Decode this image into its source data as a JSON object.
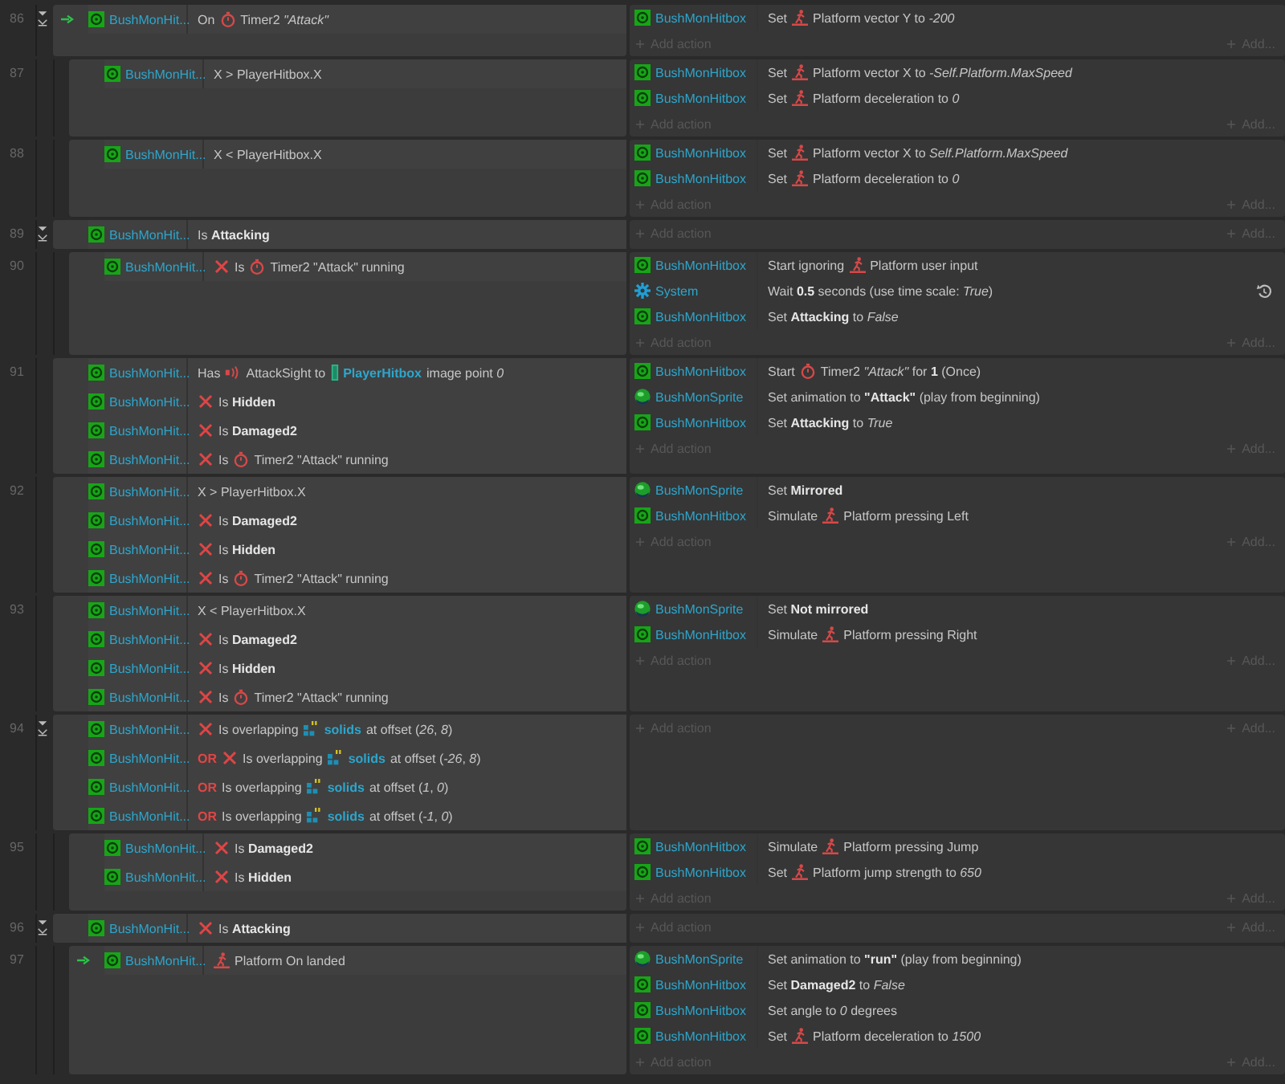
{
  "events": [
    {
      "number": "86",
      "trigger": true,
      "expanded": true,
      "conditions": [
        {
          "kind": "hitbox",
          "object": "BushMonHit...",
          "inverted": false,
          "parts": [
            {
              "kind": "text",
              "text": "On"
            },
            {
              "kind": "timer"
            },
            {
              "kind": "text",
              "text": "Timer2 *\"Attack\"*"
            }
          ]
        }
      ],
      "actions": [
        {
          "kind": "hitbox",
          "object": "BushMonHitbox",
          "parts": [
            {
              "kind": "text",
              "text": "Set"
            },
            {
              "kind": "platform"
            },
            {
              "kind": "text",
              "text": "Platform vector Y to *-200*"
            }
          ]
        }
      ],
      "add_action": "Add action",
      "add_more": "Add...",
      "children": [
        {
          "number": "87",
          "trigger": false,
          "conditions": [
            {
              "kind": "hitbox",
              "object": "BushMonHit...",
              "inverted": false,
              "parts": [
                {
                  "kind": "text",
                  "text": "X > PlayerHitbox.X"
                }
              ]
            }
          ],
          "actions": [
            {
              "kind": "hitbox",
              "object": "BushMonHitbox",
              "parts": [
                {
                  "kind": "text",
                  "text": "Set"
                },
                {
                  "kind": "platform"
                },
                {
                  "kind": "text",
                  "text": "Platform vector X to *-Self.Platform.MaxSpeed*"
                }
              ]
            },
            {
              "kind": "hitbox",
              "object": "BushMonHitbox",
              "parts": [
                {
                  "kind": "text",
                  "text": "Set"
                },
                {
                  "kind": "platform"
                },
                {
                  "kind": "text",
                  "text": "Platform deceleration to *0*"
                }
              ]
            }
          ],
          "add_action": "Add action",
          "add_more": "Add..."
        },
        {
          "number": "88",
          "trigger": false,
          "conditions": [
            {
              "kind": "hitbox",
              "object": "BushMonHit...",
              "inverted": false,
              "parts": [
                {
                  "kind": "text",
                  "text": "X < PlayerHitbox.X"
                }
              ]
            }
          ],
          "actions": [
            {
              "kind": "hitbox",
              "object": "BushMonHitbox",
              "parts": [
                {
                  "kind": "text",
                  "text": "Set"
                },
                {
                  "kind": "platform"
                },
                {
                  "kind": "text",
                  "text": "Platform vector X to *Self.Platform.MaxSpeed*"
                }
              ]
            },
            {
              "kind": "hitbox",
              "object": "BushMonHitbox",
              "parts": [
                {
                  "kind": "text",
                  "text": "Set"
                },
                {
                  "kind": "platform"
                },
                {
                  "kind": "text",
                  "text": "Platform deceleration to *0*"
                }
              ]
            }
          ],
          "add_action": "Add action",
          "add_more": "Add..."
        }
      ]
    },
    {
      "number": "89",
      "trigger": false,
      "expanded": true,
      "conditions": [
        {
          "kind": "hitbox",
          "object": "BushMonHit...",
          "inverted": false,
          "parts": [
            {
              "kind": "text",
              "text": "Is **Attacking**"
            }
          ]
        }
      ],
      "add_action": "Add action",
      "add_more": "Add...",
      "children": [
        {
          "number": "90",
          "trigger": false,
          "conditions": [
            {
              "kind": "hitbox",
              "object": "BushMonHit...",
              "inverted": true,
              "parts": [
                {
                  "kind": "text",
                  "text": "Is"
                },
                {
                  "kind": "timer"
                },
                {
                  "kind": "text",
                  "text": "Timer2 \"Attack\" running"
                }
              ]
            }
          ],
          "actions": [
            {
              "kind": "hitbox",
              "object": "BushMonHitbox",
              "parts": [
                {
                  "kind": "text",
                  "text": "Start ignoring"
                },
                {
                  "kind": "platform"
                },
                {
                  "kind": "text",
                  "text": "Platform user input"
                }
              ]
            },
            {
              "kind": "system",
              "object": "System",
              "parts": [
                {
                  "kind": "text",
                  "text": "Wait **0.5** seconds (use time scale: *True*)"
                },
                {
                  "kind": "wait"
                }
              ]
            },
            {
              "kind": "hitbox",
              "object": "BushMonHitbox",
              "parts": [
                {
                  "kind": "text",
                  "text": "Set **Attacking** to *False*"
                }
              ]
            }
          ],
          "add_action": "Add action",
          "add_more": "Add..."
        }
      ]
    },
    {
      "number": "91",
      "trigger": false,
      "conditions": [
        {
          "kind": "hitbox",
          "object": "BushMonHit...",
          "inverted": false,
          "parts": [
            {
              "kind": "text",
              "text": "Has"
            },
            {
              "kind": "sight"
            },
            {
              "kind": "text",
              "text": "AttackSight to"
            },
            {
              "kind": "player-object",
              "text": "PlayerHitbox"
            },
            {
              "kind": "text",
              "text": "image point *0*"
            }
          ]
        },
        {
          "kind": "hitbox",
          "object": "BushMonHit...",
          "inverted": true,
          "parts": [
            {
              "kind": "text",
              "text": "Is **Hidden**"
            }
          ]
        },
        {
          "kind": "hitbox",
          "object": "BushMonHit...",
          "inverted": true,
          "parts": [
            {
              "kind": "text",
              "text": "Is **Damaged2**"
            }
          ]
        },
        {
          "kind": "hitbox",
          "object": "BushMonHit...",
          "inverted": true,
          "parts": [
            {
              "kind": "text",
              "text": "Is"
            },
            {
              "kind": "timer"
            },
            {
              "kind": "text",
              "text": "Timer2 \"Attack\" running"
            }
          ]
        }
      ],
      "actions": [
        {
          "kind": "hitbox",
          "object": "BushMonHitbox",
          "parts": [
            {
              "kind": "text",
              "text": "Start"
            },
            {
              "kind": "timer"
            },
            {
              "kind": "text",
              "text": "Timer2 *\"Attack\"* for **1** (Once)"
            }
          ]
        },
        {
          "kind": "sprite",
          "object": "BushMonSprite",
          "parts": [
            {
              "kind": "text",
              "text": "Set animation to **\"Attack\"** (play from beginning)"
            }
          ]
        },
        {
          "kind": "hitbox",
          "object": "BushMonHitbox",
          "parts": [
            {
              "kind": "text",
              "text": "Set **Attacking** to *True*"
            }
          ]
        }
      ],
      "add_action": "Add action",
      "add_more": "Add..."
    },
    {
      "number": "92",
      "trigger": false,
      "conditions": [
        {
          "kind": "hitbox",
          "object": "BushMonHit...",
          "inverted": false,
          "parts": [
            {
              "kind": "text",
              "text": "X > PlayerHitbox.X"
            }
          ]
        },
        {
          "kind": "hitbox",
          "object": "BushMonHit...",
          "inverted": true,
          "parts": [
            {
              "kind": "text",
              "text": "Is **Damaged2**"
            }
          ]
        },
        {
          "kind": "hitbox",
          "object": "BushMonHit...",
          "inverted": true,
          "parts": [
            {
              "kind": "text",
              "text": "Is **Hidden**"
            }
          ]
        },
        {
          "kind": "hitbox",
          "object": "BushMonHit...",
          "inverted": true,
          "parts": [
            {
              "kind": "text",
              "text": "Is"
            },
            {
              "kind": "timer"
            },
            {
              "kind": "text",
              "text": "Timer2 \"Attack\" running"
            }
          ]
        }
      ],
      "actions": [
        {
          "kind": "sprite",
          "object": "BushMonSprite",
          "parts": [
            {
              "kind": "text",
              "text": "Set **Mirrored**"
            }
          ]
        },
        {
          "kind": "hitbox",
          "object": "BushMonHitbox",
          "parts": [
            {
              "kind": "text",
              "text": "Simulate"
            },
            {
              "kind": "platform"
            },
            {
              "kind": "text",
              "text": "Platform pressing Left"
            }
          ]
        }
      ],
      "add_action": "Add action",
      "add_more": "Add..."
    },
    {
      "number": "93",
      "trigger": false,
      "conditions": [
        {
          "kind": "hitbox",
          "object": "BushMonHit...",
          "inverted": false,
          "parts": [
            {
              "kind": "text",
              "text": "X < PlayerHitbox.X"
            }
          ]
        },
        {
          "kind": "hitbox",
          "object": "BushMonHit...",
          "inverted": true,
          "parts": [
            {
              "kind": "text",
              "text": "Is **Damaged2**"
            }
          ]
        },
        {
          "kind": "hitbox",
          "object": "BushMonHit...",
          "inverted": true,
          "parts": [
            {
              "kind": "text",
              "text": "Is **Hidden**"
            }
          ]
        },
        {
          "kind": "hitbox",
          "object": "BushMonHit...",
          "inverted": true,
          "parts": [
            {
              "kind": "text",
              "text": "Is"
            },
            {
              "kind": "timer"
            },
            {
              "kind": "text",
              "text": "Timer2 \"Attack\" running"
            }
          ]
        }
      ],
      "actions": [
        {
          "kind": "sprite",
          "object": "BushMonSprite",
          "parts": [
            {
              "kind": "text",
              "text": "Set **Not mirrored**"
            }
          ]
        },
        {
          "kind": "hitbox",
          "object": "BushMonHitbox",
          "parts": [
            {
              "kind": "text",
              "text": "Simulate"
            },
            {
              "kind": "platform"
            },
            {
              "kind": "text",
              "text": "Platform pressing Right"
            }
          ]
        }
      ],
      "add_action": "Add action",
      "add_more": "Add..."
    },
    {
      "number": "94",
      "trigger": false,
      "expanded": true,
      "conditions": [
        {
          "kind": "hitbox",
          "object": "BushMonHit...",
          "inverted": true,
          "parts": [
            {
              "kind": "text",
              "text": "Is overlapping"
            },
            {
              "kind": "tilemap-object",
              "text": "solids"
            },
            {
              "kind": "text",
              "text": "at offset (*26*, *8*)"
            }
          ]
        },
        {
          "kind": "hitbox",
          "object": "BushMonHit...",
          "or_label": "OR",
          "inverted": true,
          "parts": [
            {
              "kind": "text",
              "text": "Is overlapping"
            },
            {
              "kind": "tilemap-object",
              "text": "solids"
            },
            {
              "kind": "text",
              "text": "at offset (*-26*, *8*)"
            }
          ]
        },
        {
          "kind": "hitbox",
          "object": "BushMonHit...",
          "or_label": "OR",
          "inverted": false,
          "parts": [
            {
              "kind": "text",
              "text": "Is overlapping"
            },
            {
              "kind": "tilemap-object",
              "text": "solids"
            },
            {
              "kind": "text",
              "text": "at offset (*1*, *0*)"
            }
          ]
        },
        {
          "kind": "hitbox",
          "object": "BushMonHit...",
          "or_label": "OR",
          "inverted": false,
          "parts": [
            {
              "kind": "text",
              "text": "Is overlapping"
            },
            {
              "kind": "tilemap-object",
              "text": "solids"
            },
            {
              "kind": "text",
              "text": "at offset (*-1*, *0*)"
            }
          ]
        }
      ],
      "add_action": "Add action",
      "add_more": "Add...",
      "children": [
        {
          "number": "95",
          "trigger": false,
          "conditions": [
            {
              "kind": "hitbox",
              "object": "BushMonHit...",
              "inverted": true,
              "parts": [
                {
                  "kind": "text",
                  "text": "Is **Damaged2**"
                }
              ]
            },
            {
              "kind": "hitbox",
              "object": "BushMonHit...",
              "inverted": true,
              "parts": [
                {
                  "kind": "text",
                  "text": "Is **Hidden**"
                }
              ]
            }
          ],
          "actions": [
            {
              "kind": "hitbox",
              "object": "BushMonHitbox",
              "parts": [
                {
                  "kind": "text",
                  "text": "Simulate"
                },
                {
                  "kind": "platform"
                },
                {
                  "kind": "text",
                  "text": "Platform pressing Jump"
                }
              ]
            },
            {
              "kind": "hitbox",
              "object": "BushMonHitbox",
              "parts": [
                {
                  "kind": "text",
                  "text": "Set"
                },
                {
                  "kind": "platform"
                },
                {
                  "kind": "text",
                  "text": "Platform jump strength to *650*"
                }
              ]
            }
          ],
          "add_action": "Add action",
          "add_more": "Add..."
        }
      ]
    },
    {
      "number": "96",
      "trigger": false,
      "expanded": true,
      "conditions": [
        {
          "kind": "hitbox",
          "object": "BushMonHit...",
          "inverted": true,
          "parts": [
            {
              "kind": "text",
              "text": "Is **Attacking**"
            }
          ]
        }
      ],
      "add_action": "Add action",
      "add_more": "Add...",
      "children": [
        {
          "number": "97",
          "trigger": true,
          "conditions": [
            {
              "kind": "hitbox",
              "object": "BushMonHit...",
              "inverted": false,
              "parts": [
                {
                  "kind": "platform"
                },
                {
                  "kind": "text",
                  "text": "Platform On landed"
                }
              ]
            }
          ],
          "actions": [
            {
              "kind": "sprite",
              "object": "BushMonSprite",
              "parts": [
                {
                  "kind": "text",
                  "text": "Set animation to **\"run\"** (play from beginning)"
                }
              ]
            },
            {
              "kind": "hitbox",
              "object": "BushMonHitbox",
              "parts": [
                {
                  "kind": "text",
                  "text": "Set **Damaged2** to *False*"
                }
              ]
            },
            {
              "kind": "hitbox",
              "object": "BushMonHitbox",
              "parts": [
                {
                  "kind": "text",
                  "text": "Set angle to *0* degrees"
                }
              ]
            },
            {
              "kind": "hitbox",
              "object": "BushMonHitbox",
              "parts": [
                {
                  "kind": "text",
                  "text": "Set"
                },
                {
                  "kind": "platform"
                },
                {
                  "kind": "text",
                  "text": "Platform deceleration to *1500*"
                }
              ]
            }
          ],
          "add_action": "Add action",
          "add_more": "Add..."
        }
      ]
    }
  ]
}
